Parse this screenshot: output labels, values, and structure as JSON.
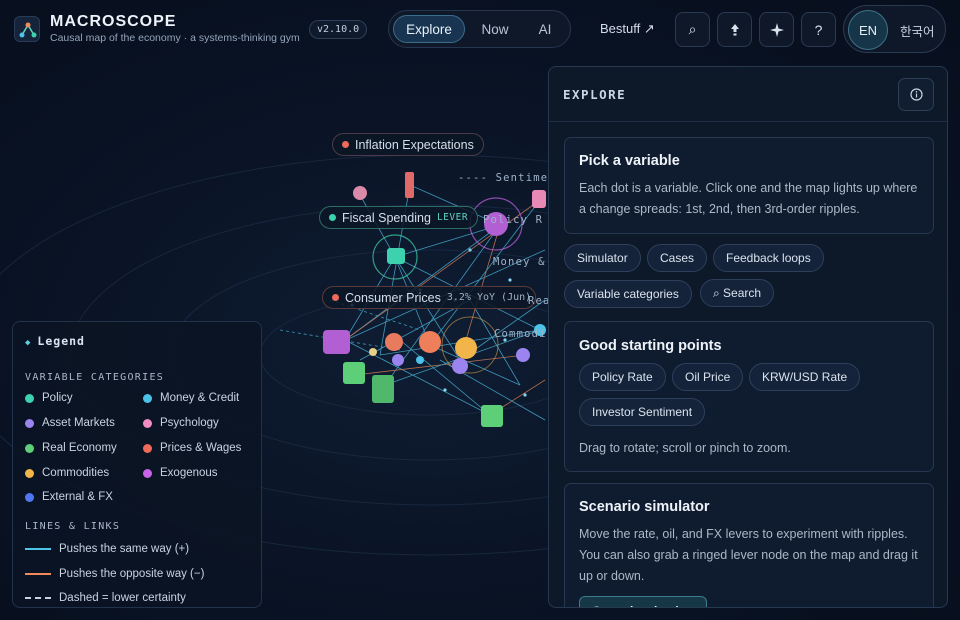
{
  "app": {
    "title": "MACROSCOPE",
    "subtitle": "Causal map of the economy · a systems-thinking gym",
    "version": "v2.10.0"
  },
  "nav": {
    "modes": [
      "Explore",
      "Now",
      "AI"
    ],
    "active_mode": "Explore",
    "external_link": "Bestuff ↗",
    "icons": [
      "search-icon",
      "share-icon",
      "sparkle-icon",
      "help-icon"
    ],
    "help_label": "?",
    "languages": [
      "EN",
      "한국어"
    ],
    "active_language": "EN"
  },
  "map": {
    "labels": {
      "inflation": "Inflation Expectations",
      "fiscal": "Fiscal Spending",
      "fiscal_tag": "LEVER",
      "consumer": "Consumer Prices",
      "consumer_value": "3.2% YoY (Jun)"
    },
    "floating": {
      "sentiment": "---- Sentiment",
      "policy": "Policy R",
      "money": "Money &",
      "commodity": "Commodi",
      "real": "Real"
    }
  },
  "legend": {
    "title": "Legend",
    "categories_header": "VARIABLE CATEGORIES",
    "categories": [
      {
        "label": "Policy",
        "color": "#3ed1ad"
      },
      {
        "label": "Money & Credit",
        "color": "#4cc2e8"
      },
      {
        "label": "Asset Markets",
        "color": "#9b84f0"
      },
      {
        "label": "Psychology",
        "color": "#f08cc2"
      },
      {
        "label": "Real Economy",
        "color": "#5ccf78"
      },
      {
        "label": "Prices & Wages",
        "color": "#ef6a5a"
      },
      {
        "label": "Commodities",
        "color": "#f2b54a"
      },
      {
        "label": "Exogenous",
        "color": "#c764e8"
      },
      {
        "label": "External & FX",
        "color": "#4d78f0"
      }
    ],
    "lines_header": "LINES & LINKS",
    "lines": [
      {
        "label": "Pushes the same way (+)",
        "color": "#4fc3e8",
        "style": "solid"
      },
      {
        "label": "Pushes the opposite way (−)",
        "color": "#f08a5a",
        "style": "solid"
      },
      {
        "label": "Dashed = lower certainty",
        "color": "#c8d3e0",
        "style": "dashed"
      }
    ]
  },
  "panel": {
    "title": "EXPLORE",
    "info_icon": "info-icon",
    "pick": {
      "title": "Pick a variable",
      "text": "Each dot is a variable. Click one and the map lights up where a change spreads: 1st, 2nd, then 3rd-order ripples."
    },
    "tools": [
      "Simulator",
      "Cases",
      "Feedback loops",
      "Variable categories",
      "⌕ Search"
    ],
    "starting": {
      "title": "Good starting points",
      "chips": [
        "Policy Rate",
        "Oil Price",
        "KRW/USD Rate",
        "Investor Sentiment"
      ],
      "hint": "Drag to rotate; scroll or pinch to zoom."
    },
    "scenario": {
      "title": "Scenario simulator",
      "text": "Move the rate, oil, and FX levers to experiment with ripples. You can also grab a ringed lever node on the map and drag it up or down.",
      "button": "Open the simulator"
    }
  }
}
